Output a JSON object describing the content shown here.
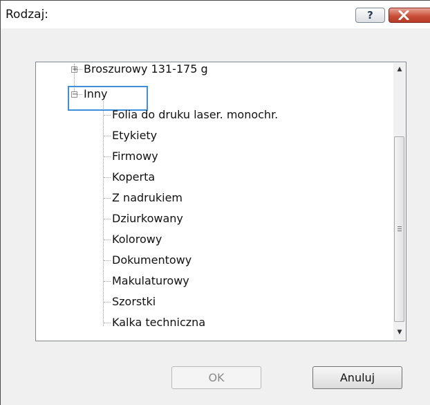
{
  "window": {
    "title": "Rodzaj:",
    "help_label": "?"
  },
  "tree": {
    "parents": [
      {
        "label": "Broszurowy 131-175 g",
        "expander": "+"
      },
      {
        "label": "Inny",
        "expander": "−"
      }
    ],
    "children": [
      "Folia do druku laser. monochr.",
      "Etykiety",
      "Firmowy",
      "Koperta",
      "Z nadrukiem",
      "Dziurkowany",
      "Kolorowy",
      "Dokumentowy",
      "Makulaturowy",
      "Szorstki",
      "Kalka techniczna"
    ]
  },
  "buttons": {
    "ok": "OK",
    "cancel": "Anuluj"
  },
  "colors": {
    "focus": "#3c8fd8",
    "close": "#c8503a"
  }
}
